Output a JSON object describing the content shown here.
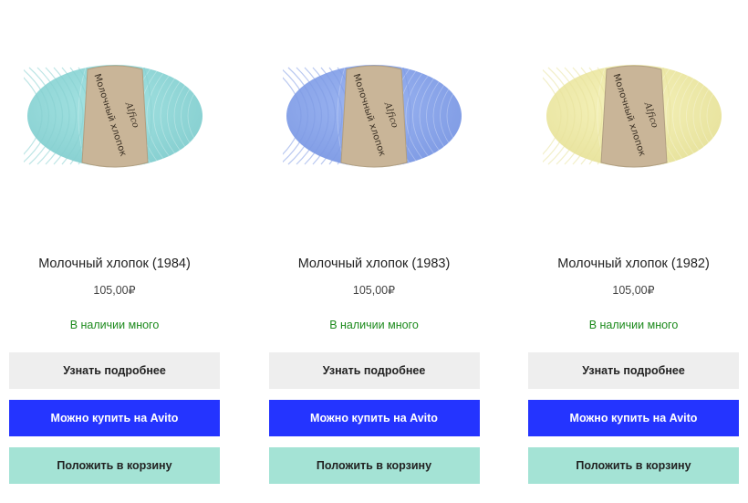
{
  "products": [
    {
      "title": "Молочный хлопок (1984)",
      "price": "105,00₽",
      "stock": "В наличии много",
      "label_text": "Молочный хлопок",
      "brand": "Alfico",
      "yarn_color": "#a6e4e3",
      "yarn_shade": "#86cfd0"
    },
    {
      "title": "Молочный хлопок (1983)",
      "price": "105,00₽",
      "stock": "В наличии много",
      "label_text": "Молочный хлопок",
      "brand": "Alfico",
      "yarn_color": "#9db6f2",
      "yarn_shade": "#7f9be4"
    },
    {
      "title": "Молочный хлопок (1982)",
      "price": "105,00₽",
      "stock": "В наличии много",
      "label_text": "Молочный хлопок",
      "brand": "Alfico",
      "yarn_color": "#f6f3bd",
      "yarn_shade": "#e7e29c"
    }
  ],
  "buttons": {
    "more": "Узнать подробнее",
    "avito": "Можно купить на Avito",
    "cart": "Положить в корзину"
  },
  "colors": {
    "avito_button": "#2434ff",
    "cart_button": "#a4e3d5",
    "more_button": "#eeeeee",
    "stock_text": "#1c8a1c",
    "label_paper": "#c9b598"
  }
}
